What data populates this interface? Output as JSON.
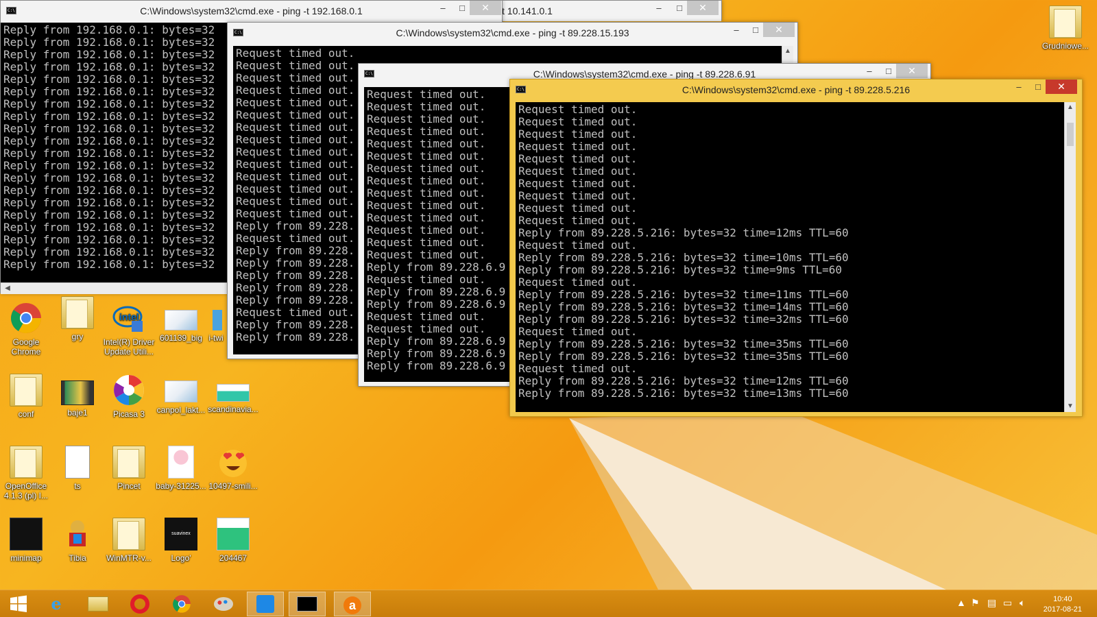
{
  "windows": {
    "w1": {
      "title": "C:\\Windows\\system32\\cmd.exe - ping  -t 192.168.0.1",
      "lines": [
        "Reply from 192.168.0.1: bytes=32",
        "Reply from 192.168.0.1: bytes=32",
        "Reply from 192.168.0.1: bytes=32",
        "Reply from 192.168.0.1: bytes=32",
        "Reply from 192.168.0.1: bytes=32",
        "Reply from 192.168.0.1: bytes=32",
        "Reply from 192.168.0.1: bytes=32",
        "Reply from 192.168.0.1: bytes=32",
        "Reply from 192.168.0.1: bytes=32",
        "Reply from 192.168.0.1: bytes=32",
        "Reply from 192.168.0.1: bytes=32",
        "Reply from 192.168.0.1: bytes=32",
        "Reply from 192.168.0.1: bytes=32",
        "Reply from 192.168.0.1: bytes=32",
        "Reply from 192.168.0.1: bytes=32",
        "Reply from 192.168.0.1: bytes=32",
        "Reply from 192.168.0.1: bytes=32",
        "Reply from 192.168.0.1: bytes=32",
        "Reply from 192.168.0.1: bytes=32",
        "Reply from 192.168.0.1: bytes=32"
      ]
    },
    "w2": {
      "title": "t 10.141.0.1"
    },
    "w3": {
      "title": "C:\\Windows\\system32\\cmd.exe - ping  -t 89.228.15.193",
      "lines": [
        "Request timed out.",
        "Request timed out.",
        "Request timed out.",
        "Request timed out.",
        "Request timed out.",
        "Request timed out.",
        "Request timed out.",
        "Request timed out.",
        "Request timed out.",
        "Request timed out.",
        "Request timed out.",
        "Request timed out.",
        "Request timed out.",
        "Request timed out.",
        "Reply from 89.228.",
        "Request timed out.",
        "Reply from 89.228.",
        "Reply from 89.228.",
        "Reply from 89.228.",
        "Reply from 89.228.",
        "Reply from 89.228.",
        "Request timed out.",
        "Reply from 89.228.",
        "Reply from 89.228."
      ]
    },
    "w4": {
      "title": "C:\\Windows\\system32\\cmd.exe - ping  -t 89.228.6.91",
      "lines": [
        "Request timed out.",
        "Request timed out.",
        "Request timed out.",
        "Request timed out.",
        "Request timed out.",
        "Request timed out.",
        "Request timed out.",
        "Request timed out.",
        "Request timed out.",
        "Request timed out.",
        "Request timed out.",
        "Request timed out.",
        "Request timed out.",
        "Request timed out.",
        "Reply from 89.228.6.9",
        "Request timed out.",
        "Reply from 89.228.6.9",
        "Reply from 89.228.6.9",
        "Request timed out.",
        "Request timed out.",
        "Reply from 89.228.6.9",
        "Reply from 89.228.6.9",
        "Reply from 89.228.6.9"
      ]
    },
    "w5": {
      "title": "C:\\Windows\\system32\\cmd.exe - ping  -t 89.228.5.216",
      "lines": [
        "Request timed out.",
        "Request timed out.",
        "Request timed out.",
        "Request timed out.",
        "Request timed out.",
        "Request timed out.",
        "Request timed out.",
        "Request timed out.",
        "Request timed out.",
        "Request timed out.",
        "Reply from 89.228.5.216: bytes=32 time=12ms TTL=60",
        "Request timed out.",
        "Reply from 89.228.5.216: bytes=32 time=10ms TTL=60",
        "Reply from 89.228.5.216: bytes=32 time=9ms TTL=60",
        "Request timed out.",
        "Reply from 89.228.5.216: bytes=32 time=11ms TTL=60",
        "Reply from 89.228.5.216: bytes=32 time=14ms TTL=60",
        "Reply from 89.228.5.216: bytes=32 time=32ms TTL=60",
        "Request timed out.",
        "Reply from 89.228.5.216: bytes=32 time=35ms TTL=60",
        "Reply from 89.228.5.216: bytes=32 time=35ms TTL=60",
        "Request timed out.",
        "Reply from 89.228.5.216: bytes=32 time=12ms TTL=60",
        "Reply from 89.228.5.216: bytes=32 time=13ms TTL=60"
      ]
    }
  },
  "window_controls": {
    "minimize": "–",
    "maximize": "□",
    "close": "✕"
  },
  "desktop_icons": {
    "google_chrome": "Google Chrome",
    "gry": "gry",
    "intel": "Intel(R) Driver Update Utili...",
    "img601139": "601139_big",
    "itwi": "i-twi",
    "conf": "conf",
    "baje1": "baje1",
    "picasa": "Picasa 3",
    "canpol": "canpol_lakt...",
    "scandinavia": "scandinavia...",
    "openoffice": "OpenOffice 4.1.3 (pl) I...",
    "ts": "ts",
    "pincet": "Pincet",
    "baby": "baby-31225...",
    "smili": "10497-smili...",
    "minimap": "minimap",
    "tibia": "Tibia",
    "winmtr": "WinMTR-v...",
    "logo": "Logo'",
    "n204467": "204467",
    "grudniowe": "Grudniowe..."
  },
  "logo_text": "suavinex",
  "taskbar": {
    "icons": [
      "start-icon",
      "ie-icon",
      "explorer-icon",
      "opera-icon",
      "chrome-icon",
      "paint-icon",
      "pwsafe-icon",
      "cmd-icon",
      "avast-icon"
    ],
    "clock_time": "10:40",
    "clock_date": "2017-08-21"
  },
  "colors": {
    "desktop": "#f6a314",
    "active_title": "#f4cb4f",
    "close_active": "#c7392b",
    "console_bg": "#000000",
    "console_fg": "#c0c0c0"
  }
}
